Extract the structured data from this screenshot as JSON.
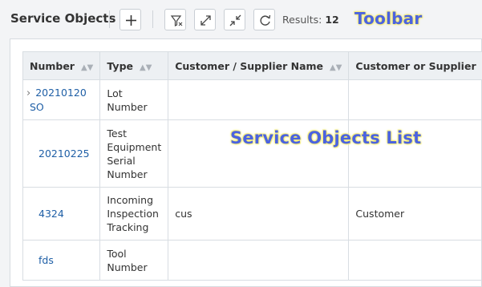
{
  "toolbar": {
    "title": "Service Objects",
    "results_label": "Results:",
    "results_count": "12",
    "annotation": "Toolbar",
    "icons": [
      "plus-icon",
      "filter-icon",
      "expand-icon",
      "collapse-icon",
      "refresh-icon"
    ]
  },
  "list": {
    "annotation": "Service Objects List",
    "columns": [
      "Number",
      "Type",
      "Customer / Supplier Name",
      "Customer or Supplier"
    ],
    "rows": [
      {
        "number": "20210120 SO",
        "type": "Lot Number",
        "name": "",
        "cos": ""
      },
      {
        "number": "20210225",
        "type": "Test Equipment Serial Number",
        "name": "",
        "cos": ""
      },
      {
        "number": "4324",
        "type": "Incoming Inspection Tracking",
        "name": "cus",
        "cos": "Customer"
      },
      {
        "number": "fds",
        "type": "Tool Number",
        "name": "",
        "cos": ""
      }
    ]
  },
  "colors": {
    "link": "#1f5fa6",
    "annotation": "#4b63e0",
    "annotation_glow": "#f3e96b"
  }
}
